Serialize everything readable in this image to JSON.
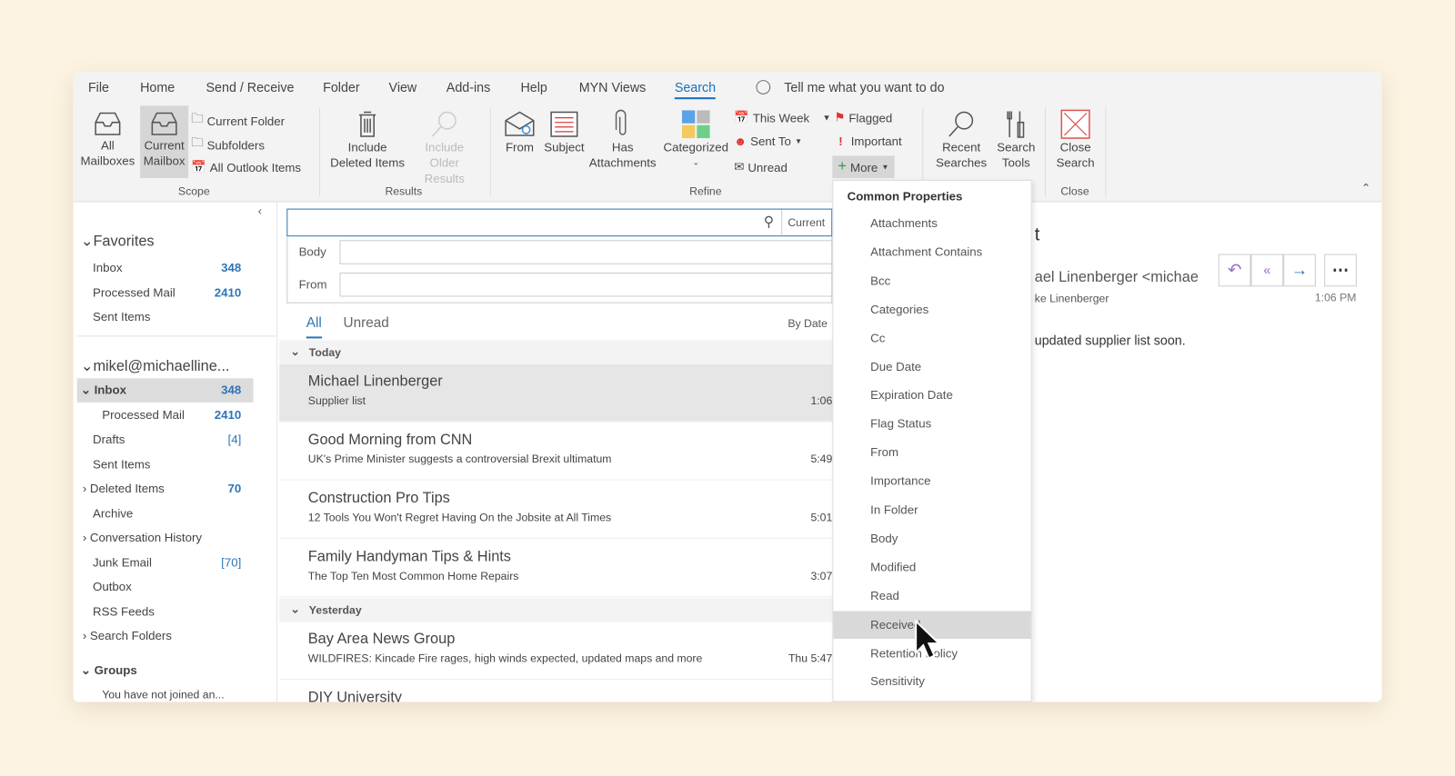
{
  "menu": [
    "File",
    "Home",
    "Send / Receive",
    "Folder",
    "View",
    "Add-ins",
    "Help",
    "MYN Views",
    "Search"
  ],
  "tell_me": "Tell me what you want to do",
  "scope": {
    "all_mailboxes": [
      "All",
      "Mailboxes"
    ],
    "current_mailbox": [
      "Current",
      "Mailbox"
    ],
    "current_folder": "Current Folder",
    "subfolders": "Subfolders",
    "all_outlook_items": "All Outlook Items",
    "group": "Scope"
  },
  "results": {
    "include_deleted": [
      "Include",
      "Deleted Items"
    ],
    "include_older": [
      "Include",
      "Older Results"
    ],
    "group": "Results"
  },
  "refine": {
    "from": "From",
    "subject": "Subject",
    "has_attachments": [
      "Has",
      "Attachments"
    ],
    "categorized": "Categorized",
    "this_week": "This Week",
    "sent_to": "Sent To",
    "unread": "Unread",
    "flagged": "Flagged",
    "important": "Important",
    "more": "More",
    "group": "Refine"
  },
  "options": {
    "recent_searches": [
      "Recent",
      "Searches"
    ],
    "search_tools": [
      "Search",
      "Tools"
    ]
  },
  "close": {
    "close_search": [
      "Close",
      "Search"
    ],
    "group": "Close"
  },
  "nav": {
    "favorites": "Favorites",
    "fav_items": [
      {
        "label": "Inbox",
        "count": "348"
      },
      {
        "label": "Processed Mail",
        "count": "2410"
      },
      {
        "label": "Sent Items",
        "count": ""
      }
    ],
    "account": "mikel@michaelline...",
    "folders": [
      {
        "label": "Inbox",
        "count": "348"
      },
      {
        "label": "Processed Mail",
        "count": "2410"
      },
      {
        "label": "Drafts",
        "count": "[4]"
      },
      {
        "label": "Sent Items",
        "count": ""
      },
      {
        "label": "Deleted Items",
        "count": "70"
      },
      {
        "label": "Archive",
        "count": ""
      },
      {
        "label": "Conversation History",
        "count": ""
      },
      {
        "label": "Junk Email",
        "count": "[70]"
      },
      {
        "label": "Outbox",
        "count": ""
      },
      {
        "label": "RSS Feeds",
        "count": ""
      },
      {
        "label": "Search Folders",
        "count": ""
      }
    ],
    "groups": "Groups",
    "groups_note": "You have not joined an..."
  },
  "search": {
    "scope_label": "Current",
    "body_label": "Body",
    "from_label": "From"
  },
  "list": {
    "tab_all": "All",
    "tab_unread": "Unread",
    "sort": "By Date",
    "today": "Today",
    "yesterday": "Yesterday",
    "emails": [
      {
        "sender": "Michael Linenberger",
        "subject": "Supplier list",
        "time": "1:06"
      },
      {
        "sender": "Good Morning from CNN",
        "subject": "UK's Prime Minister suggests a controversial Brexit ultimatum",
        "time": "5:49"
      },
      {
        "sender": "Construction Pro Tips",
        "subject": "12 Tools You Won't Regret Having On the Jobsite at All Times",
        "time": "5:01"
      },
      {
        "sender": "Family Handyman Tips & Hints",
        "subject": "The Top Ten Most Common Home Repairs",
        "time": "3:07"
      },
      {
        "sender": "Bay Area News Group",
        "subject": "WILDFIRES: Kincade Fire rages, high winds expected, updated maps and more",
        "time": "Thu 5:47"
      },
      {
        "sender": "DIY University",
        "subject": "",
        "time": ""
      }
    ]
  },
  "dropdown": {
    "header": "Common Properties",
    "items": [
      "Attachments",
      "Attachment Contains",
      "Bcc",
      "Categories",
      "Cc",
      "Due Date",
      "Expiration Date",
      "Flag Status",
      "From",
      "Importance",
      "In Folder",
      "Body",
      "Modified",
      "Read",
      "Received",
      "Retention Policy",
      "Sensitivity"
    ],
    "highlighted": "Received"
  },
  "reading": {
    "title_frag": "t",
    "from_frag": "ael Linenberger <michae",
    "to_frag": "ke Linenberger",
    "time": "1:06 PM",
    "body_frag": "updated supplier list soon."
  }
}
